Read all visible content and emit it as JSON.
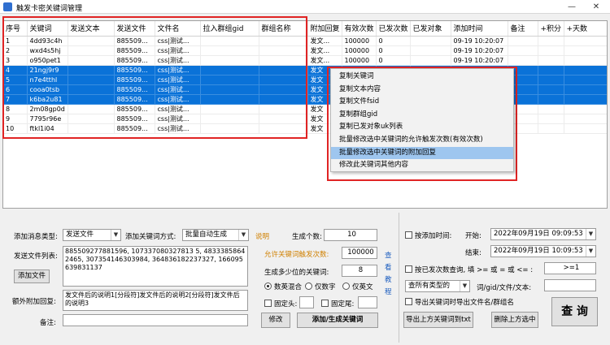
{
  "window": {
    "title": "触发卡密关键词管理",
    "minimize": "—",
    "close": "✕"
  },
  "grid": {
    "columns": [
      "序号",
      "关键词",
      "发送文本",
      "发送文件",
      "文件名",
      "拉入群组gid",
      "群组名称",
      "附加回复",
      "有效次数",
      "已发次数",
      "已发对象",
      "添加时间",
      "备注",
      "+积分",
      "+天数"
    ],
    "rows": [
      {
        "no": "1",
        "kw": "4dd93c4h",
        "file": "885509...",
        "fname": "css|测试...",
        "extra": "发文...",
        "valid": "100000",
        "sent": "0",
        "time": "09-19 10:20:07",
        "selected": false
      },
      {
        "no": "2",
        "kw": "wxd4s5hj",
        "file": "885509...",
        "fname": "css|测试...",
        "extra": "发文...",
        "valid": "100000",
        "sent": "0",
        "time": "09-19 10:20:07",
        "selected": false
      },
      {
        "no": "3",
        "kw": "o950pet1",
        "file": "885509...",
        "fname": "css|测试...",
        "extra": "发文...",
        "valid": "100000",
        "sent": "0",
        "time": "09-19 10:20:07",
        "selected": false
      },
      {
        "no": "4",
        "kw": "21ngj9r9",
        "file": "885509...",
        "fname": "css|测试...",
        "extra": "发文",
        "valid": "",
        "sent": "",
        "time": "",
        "selected": true
      },
      {
        "no": "5",
        "kw": "n7e4tthl",
        "file": "885509...",
        "fname": "css|测试...",
        "extra": "发文",
        "valid": "",
        "sent": "",
        "time": "",
        "selected": true
      },
      {
        "no": "6",
        "kw": "cooa0tsb",
        "file": "885509...",
        "fname": "css|测试...",
        "extra": "发文",
        "valid": "",
        "sent": "",
        "time": "",
        "selected": true
      },
      {
        "no": "7",
        "kw": "k6ba2u81",
        "file": "885509...",
        "fname": "css|测试...",
        "extra": "发文",
        "valid": "",
        "sent": "",
        "time": "",
        "selected": true
      },
      {
        "no": "8",
        "kw": "2m08gp0d",
        "file": "885509...",
        "fname": "css|测试...",
        "extra": "发文",
        "valid": "",
        "sent": "",
        "time": "",
        "selected": false
      },
      {
        "no": "9",
        "kw": "7795r96e",
        "file": "885509...",
        "fname": "css|测试...",
        "extra": "发文",
        "valid": "",
        "sent": "",
        "time": "",
        "selected": false
      },
      {
        "no": "10",
        "kw": "ftkl1i04",
        "file": "885509...",
        "fname": "css|测试...",
        "extra": "发文",
        "valid": "",
        "sent": "",
        "time": "",
        "selected": false
      }
    ]
  },
  "context_menu": {
    "items": [
      "复制关键词",
      "复制文本内容",
      "复制文件fsid",
      "复制群组gid",
      "复制已发对象uk列表",
      "批量修改选中关键词的允许触发次数(有效次数)",
      "批量修改选中关键词的附加回复",
      "修改此关键词其他内容"
    ],
    "highlighted_index": 6
  },
  "form": {
    "msg_type_label": "添加消息类型:",
    "msg_type_value": "发送文件",
    "kw_mode_label": "添加关键词方式:",
    "kw_mode_value": "批量自动生成",
    "help_link": "说明",
    "file_list_label": "发送文件列表:",
    "file_list_value": "885509277881596, 107337080327813 5, 48333858642465, 307354146303984, 364836182237327, 166095639831137",
    "add_file_button": "添加文件",
    "extra_reply_label": "额外附加回复:",
    "extra_reply_value": "发文件后的说明1[分段符]发文件后的说明2[分段符]发文件后的说明3",
    "note_label": "备注:",
    "note_value": "",
    "gen_count_label": "生成个数:",
    "gen_count_value": "10",
    "allow_count_label": "允许关键词触发次数:",
    "allow_count_value": "100000",
    "kw_digits_label": "生成多少位的关键词:",
    "kw_digits_value": "8",
    "radio_mixed": "数英混合",
    "radio_digits": "仅数字",
    "radio_letters": "仅英文",
    "fixed_head_label": "固定头:",
    "fixed_tail_label": "固定尾:",
    "tutorial_link": "查看教程",
    "modify_button": "修改",
    "add_gen_button": "添加/生成关键词"
  },
  "query": {
    "by_time_label": "按添加时间:",
    "start_label": "开始:",
    "start_value": "2022年09月19日  09:09:53",
    "end_label": "结束:",
    "end_value": "2022年09月19日  10:09:53",
    "by_sent_label": "按已发次数查询, 填 >= 或 = 或 <= :",
    "sent_value": ">=1",
    "type_value": "查所有类型的",
    "kw_search_label": "词/gid/文件/文本:",
    "export_check_label": "导出关键词时导出文件名/群组名",
    "export_button": "导出上方关键词到txt",
    "delete_button": "删除上方选中",
    "query_button": "查 询"
  },
  "colors": {
    "selection": "#0a72d8",
    "highlight": "#9ec6ef",
    "annotation": "#e02424",
    "link": "#d08000"
  }
}
